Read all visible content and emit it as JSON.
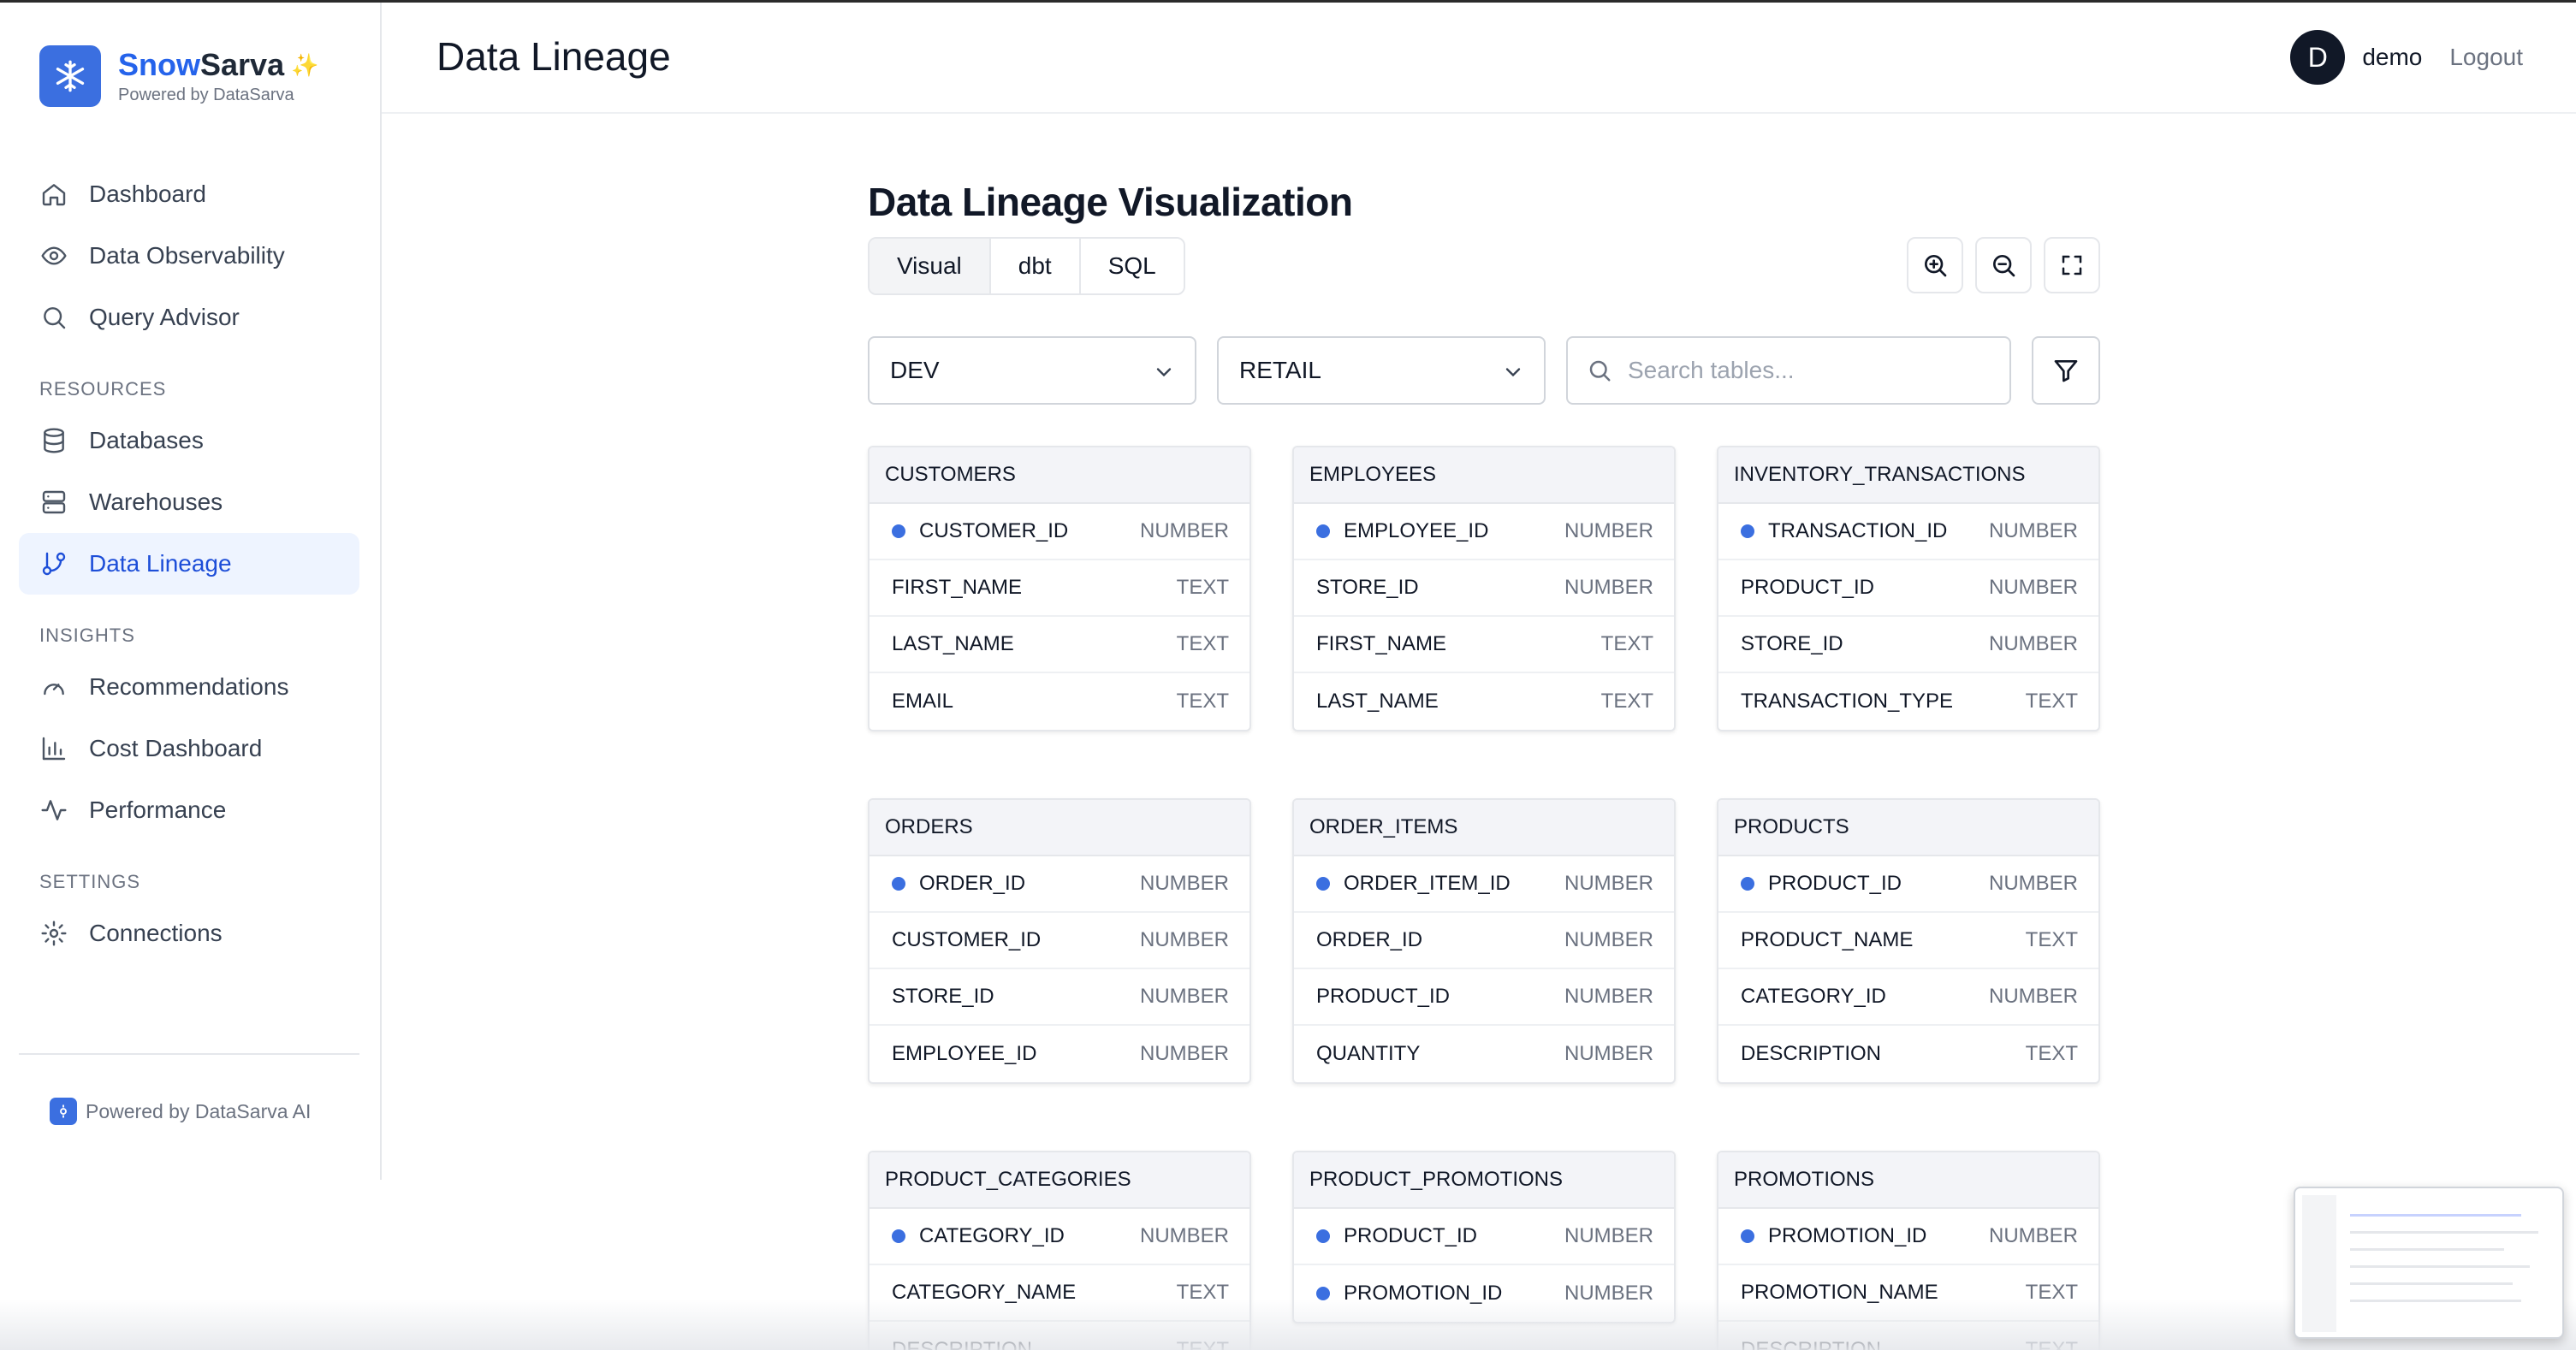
{
  "brand": {
    "name_part1": "Snow",
    "name_part2": "Sarva",
    "tagline": "Powered by DataSarva"
  },
  "sidebar": {
    "main_items": [
      {
        "label": "Dashboard",
        "icon": "home-icon"
      },
      {
        "label": "Data Observability",
        "icon": "eye-icon"
      },
      {
        "label": "Query Advisor",
        "icon": "search-icon"
      }
    ],
    "sections": [
      {
        "title": "RESOURCES",
        "items": [
          {
            "label": "Databases",
            "icon": "database-icon"
          },
          {
            "label": "Warehouses",
            "icon": "server-icon"
          },
          {
            "label": "Data Lineage",
            "icon": "git-branch-icon",
            "active": true
          }
        ]
      },
      {
        "title": "INSIGHTS",
        "items": [
          {
            "label": "Recommendations",
            "icon": "gauge-icon"
          },
          {
            "label": "Cost Dashboard",
            "icon": "bar-chart-icon"
          },
          {
            "label": "Performance",
            "icon": "activity-icon"
          }
        ]
      },
      {
        "title": "SETTINGS",
        "items": [
          {
            "label": "Connections",
            "icon": "gear-icon"
          }
        ]
      }
    ],
    "footer": "Powered by DataSarva AI"
  },
  "header": {
    "title": "Data Lineage",
    "avatar_initial": "D",
    "username": "demo",
    "logout_label": "Logout"
  },
  "main": {
    "title": "Data Lineage Visualization",
    "tabs": [
      {
        "label": "Visual",
        "active": true
      },
      {
        "label": "dbt"
      },
      {
        "label": "SQL"
      }
    ],
    "database_select": "DEV",
    "schema_select": "RETAIL",
    "search_placeholder": "Search tables...",
    "tables": [
      {
        "name": "CUSTOMERS",
        "columns": [
          {
            "name": "CUSTOMER_ID",
            "type": "NUMBER",
            "pk": true
          },
          {
            "name": "FIRST_NAME",
            "type": "TEXT"
          },
          {
            "name": "LAST_NAME",
            "type": "TEXT"
          },
          {
            "name": "EMAIL",
            "type": "TEXT"
          }
        ]
      },
      {
        "name": "EMPLOYEES",
        "columns": [
          {
            "name": "EMPLOYEE_ID",
            "type": "NUMBER",
            "pk": true
          },
          {
            "name": "STORE_ID",
            "type": "NUMBER"
          },
          {
            "name": "FIRST_NAME",
            "type": "TEXT"
          },
          {
            "name": "LAST_NAME",
            "type": "TEXT"
          }
        ]
      },
      {
        "name": "INVENTORY_TRANSACTIONS",
        "columns": [
          {
            "name": "TRANSACTION_ID",
            "type": "NUMBER",
            "pk": true
          },
          {
            "name": "PRODUCT_ID",
            "type": "NUMBER"
          },
          {
            "name": "STORE_ID",
            "type": "NUMBER"
          },
          {
            "name": "TRANSACTION_TYPE",
            "type": "TEXT"
          }
        ]
      },
      {
        "name": "ORDERS",
        "columns": [
          {
            "name": "ORDER_ID",
            "type": "NUMBER",
            "pk": true
          },
          {
            "name": "CUSTOMER_ID",
            "type": "NUMBER"
          },
          {
            "name": "STORE_ID",
            "type": "NUMBER"
          },
          {
            "name": "EMPLOYEE_ID",
            "type": "NUMBER"
          }
        ]
      },
      {
        "name": "ORDER_ITEMS",
        "columns": [
          {
            "name": "ORDER_ITEM_ID",
            "type": "NUMBER",
            "pk": true
          },
          {
            "name": "ORDER_ID",
            "type": "NUMBER"
          },
          {
            "name": "PRODUCT_ID",
            "type": "NUMBER"
          },
          {
            "name": "QUANTITY",
            "type": "NUMBER"
          }
        ]
      },
      {
        "name": "PRODUCTS",
        "columns": [
          {
            "name": "PRODUCT_ID",
            "type": "NUMBER",
            "pk": true
          },
          {
            "name": "PRODUCT_NAME",
            "type": "TEXT"
          },
          {
            "name": "CATEGORY_ID",
            "type": "NUMBER"
          },
          {
            "name": "DESCRIPTION",
            "type": "TEXT"
          }
        ]
      },
      {
        "name": "PRODUCT_CATEGORIES",
        "columns": [
          {
            "name": "CATEGORY_ID",
            "type": "NUMBER",
            "pk": true
          },
          {
            "name": "CATEGORY_NAME",
            "type": "TEXT"
          },
          {
            "name": "DESCRIPTION",
            "type": "TEXT"
          }
        ]
      },
      {
        "name": "PRODUCT_PROMOTIONS",
        "columns": [
          {
            "name": "PRODUCT_ID",
            "type": "NUMBER",
            "pk": true
          },
          {
            "name": "PROMOTION_ID",
            "type": "NUMBER",
            "pk": true
          }
        ]
      },
      {
        "name": "PROMOTIONS",
        "columns": [
          {
            "name": "PROMOTION_ID",
            "type": "NUMBER",
            "pk": true
          },
          {
            "name": "PROMOTION_NAME",
            "type": "TEXT"
          },
          {
            "name": "DESCRIPTION",
            "type": "TEXT"
          }
        ]
      }
    ]
  },
  "colors": {
    "accent": "#2563eb",
    "pk_dot": "#3b6fe0",
    "active_nav_bg": "#eef4ff"
  }
}
